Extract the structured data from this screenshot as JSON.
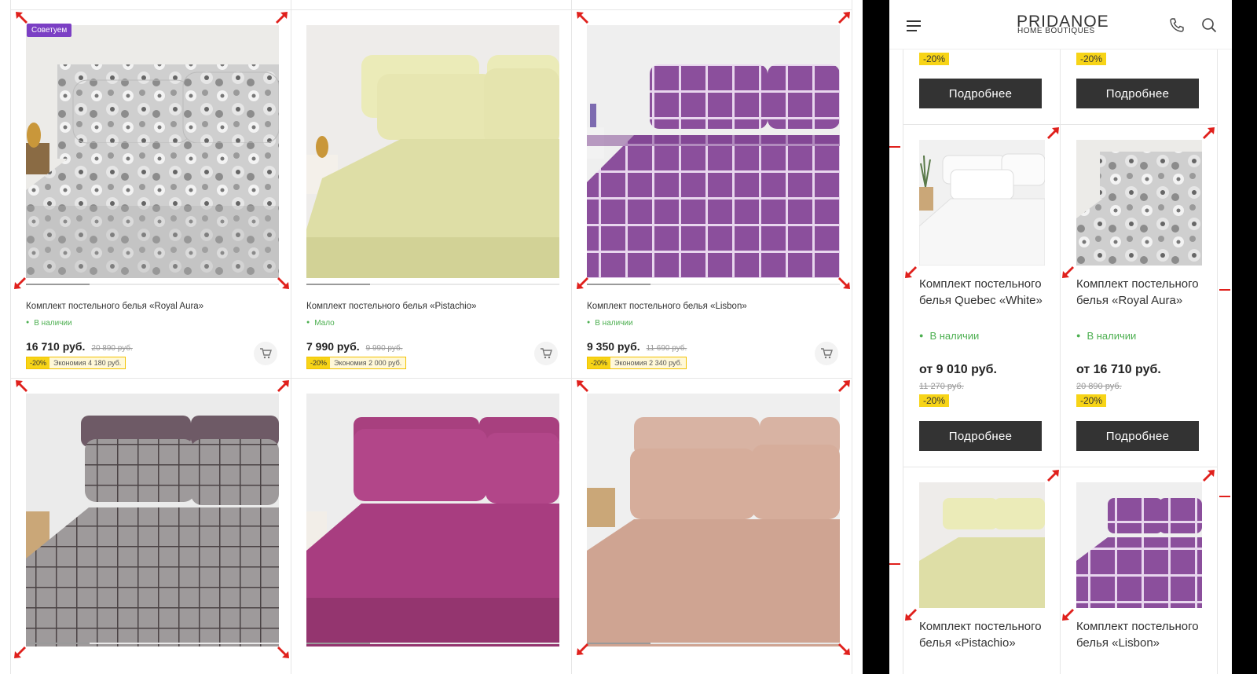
{
  "desktop": {
    "products": [
      {
        "title": "Комплект постельного белья «Royal Aura»",
        "stock": "В наличии",
        "price": "16 710 руб.",
        "old_price": "20 890 руб.",
        "pct": "-20%",
        "savings": "Экономия 4 180 руб.",
        "badge": "Советуем"
      },
      {
        "title": "Комплект постельного белья «Pistachio»",
        "stock": "Мало",
        "price": "7 990 руб.",
        "old_price": "9 990 руб.",
        "pct": "-20%",
        "savings": "Экономия 2 000 руб."
      },
      {
        "title": "Комплект постельного белья «Lisbon»",
        "stock": "В наличии",
        "price": "9 350 руб.",
        "old_price": "11 690 руб.",
        "pct": "-20%",
        "savings": "Экономия 2 340 руб."
      }
    ]
  },
  "mobile": {
    "header": {
      "logo_top": "PRIDANOE",
      "logo_bottom": "HOME BOUTIQUES",
      "icons": [
        "menu-icon",
        "phone-icon",
        "search-icon"
      ]
    },
    "top_row": {
      "pct": "-20%",
      "button": "Подробнее"
    },
    "products": [
      {
        "title": "Комплект постельного белья Quebec «White»",
        "stock": "В наличии",
        "price": "от 9 010 руб.",
        "old_price": "11 270 руб.",
        "pct": "-20%",
        "button": "Подробнее"
      },
      {
        "title": "Комплект постельного белья «Royal Aura»",
        "stock": "В наличии",
        "price": "от 16 710 руб.",
        "old_price": "20 890 руб.",
        "pct": "-20%",
        "button": "Подробнее"
      },
      {
        "title": "Комплект постельного белья «Pistachio»"
      },
      {
        "title": "Комплект постельного белья «Lisbon»"
      }
    ]
  },
  "colors": {
    "accent_purple": "#7b3fc4",
    "discount_yellow": "#f7d417",
    "stock_green": "#4caf50",
    "button_dark": "#333333",
    "marker_red": "#e0201c"
  }
}
